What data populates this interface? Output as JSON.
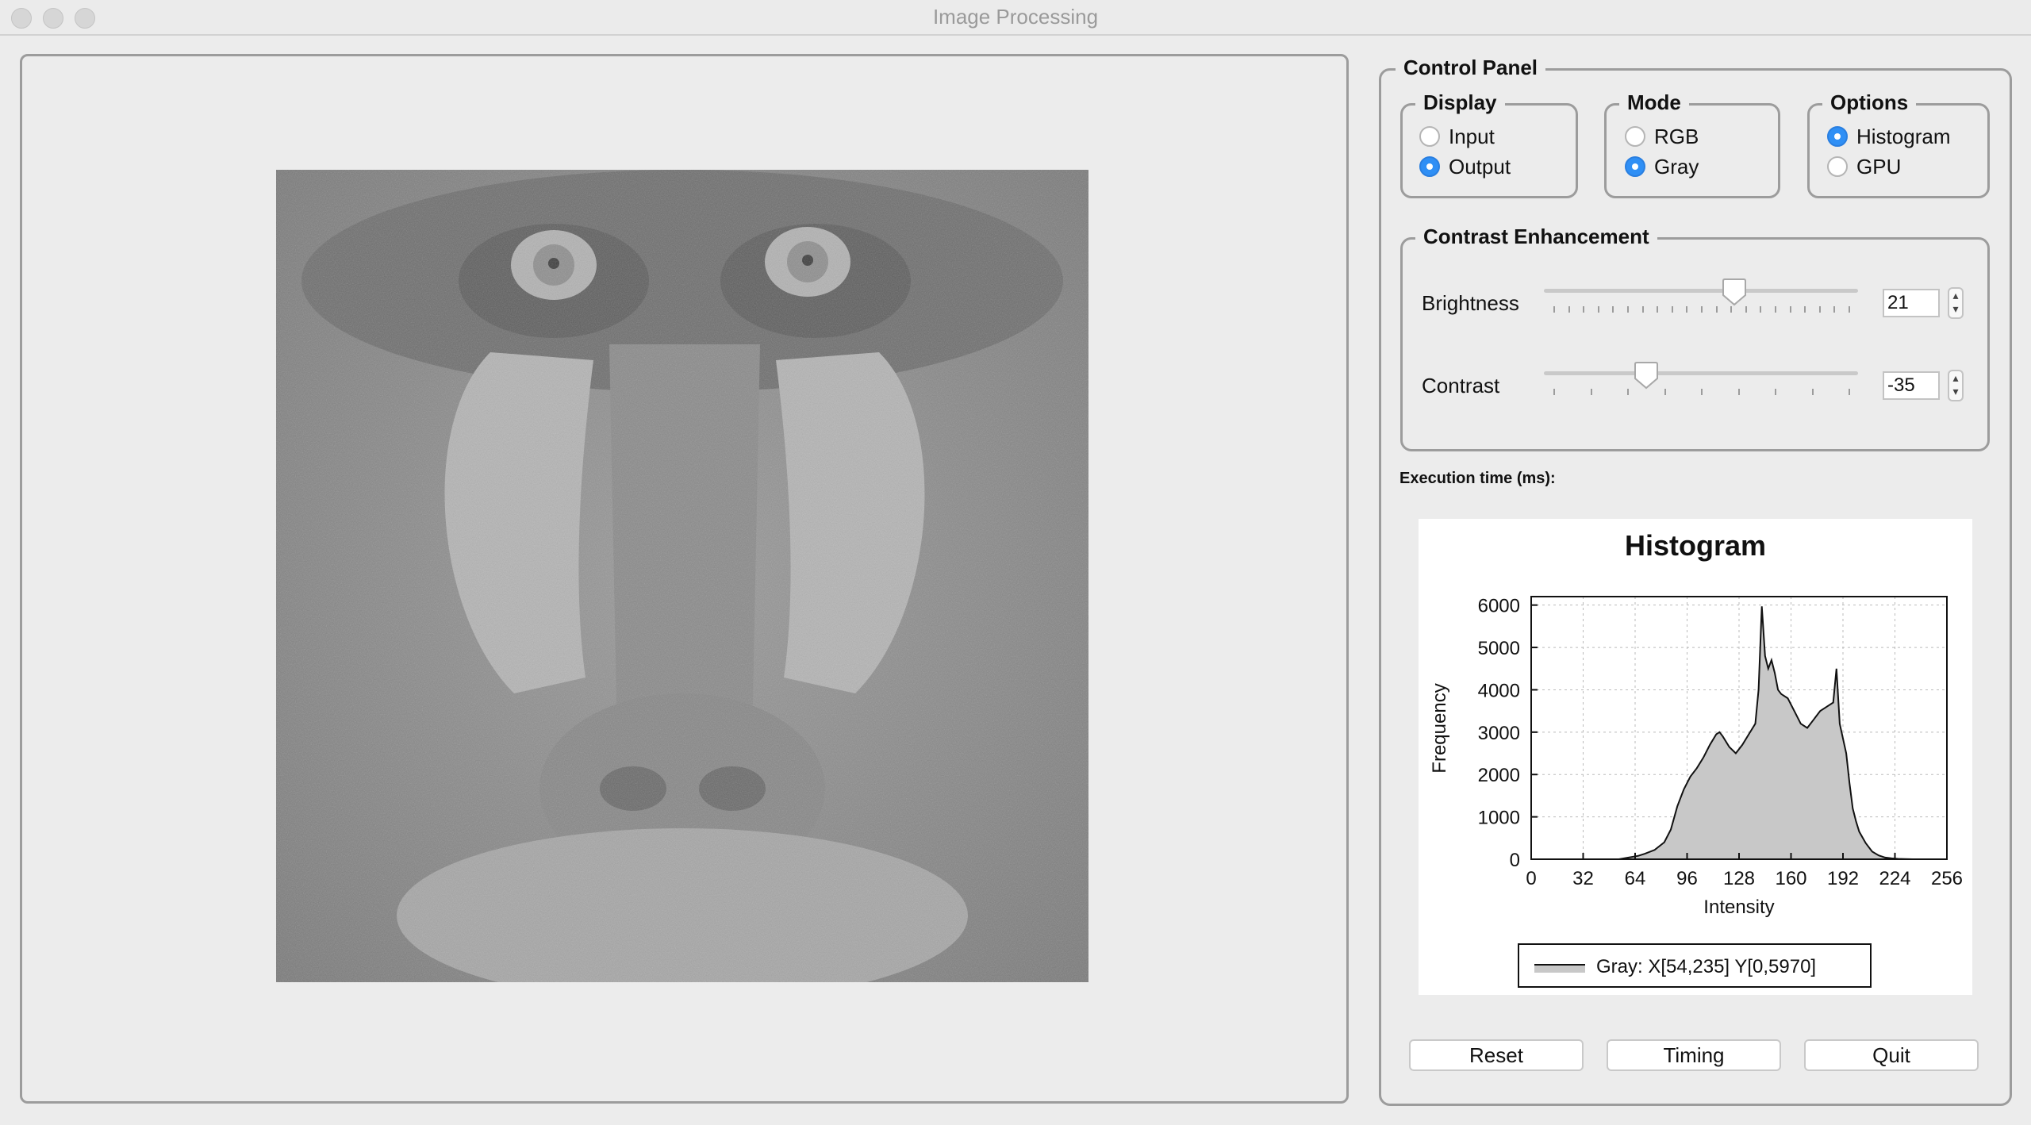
{
  "window": {
    "title": "Image Processing"
  },
  "control_panel": {
    "title": "Control Panel",
    "display": {
      "title": "Display",
      "options": [
        {
          "label": "Input",
          "selected": false
        },
        {
          "label": "Output",
          "selected": true
        }
      ]
    },
    "mode": {
      "title": "Mode",
      "options": [
        {
          "label": "RGB",
          "selected": false
        },
        {
          "label": "Gray",
          "selected": true
        }
      ]
    },
    "options": {
      "title": "Options",
      "options": [
        {
          "label": "Histogram",
          "selected": true
        },
        {
          "label": "GPU",
          "selected": false
        }
      ]
    },
    "contrast_enhancement": {
      "title": "Contrast Enhancement",
      "brightness": {
        "label": "Brightness",
        "value": "21",
        "level": 21,
        "min": -100,
        "max": 100
      },
      "contrast": {
        "label": "Contrast",
        "value": "-35",
        "level": -35,
        "min": -100,
        "max": 100
      }
    },
    "execution_time_label": "Execution time (ms):"
  },
  "buttons": {
    "reset": "Reset",
    "timing": "Timing",
    "quit": "Quit"
  },
  "colors": {
    "accent": "#2f8ff5",
    "histogram_fill": "#c8c8c8",
    "histogram_line": "#111111"
  },
  "chart_data": {
    "type": "area",
    "title": "Histogram",
    "xlabel": "Intensity",
    "ylabel": "Frequency",
    "xlim": [
      0,
      256
    ],
    "ylim": [
      0,
      6200
    ],
    "x_ticks": [
      "0",
      "32",
      "64",
      "96",
      "128",
      "160",
      "192",
      "224",
      "256"
    ],
    "y_ticks": [
      "0",
      "1000",
      "2000",
      "3000",
      "4000",
      "5000",
      "6000"
    ],
    "grid": true,
    "legend": {
      "placement": "bottom",
      "text": "Gray: X[54,235] Y[0,5970]"
    },
    "series": [
      {
        "name": "Gray",
        "x": [
          54,
          60,
          66,
          70,
          76,
          82,
          86,
          90,
          94,
          98,
          102,
          106,
          110,
          114,
          116,
          118,
          122,
          126,
          130,
          134,
          138,
          140,
          142,
          144,
          146,
          148,
          150,
          152,
          154,
          158,
          162,
          166,
          170,
          174,
          178,
          182,
          186,
          188,
          190,
          194,
          196,
          198,
          200,
          202,
          206,
          210,
          214,
          218,
          222,
          226,
          230,
          235
        ],
        "y": [
          0,
          40,
          80,
          130,
          220,
          400,
          700,
          1250,
          1650,
          1950,
          2150,
          2400,
          2700,
          2950,
          3000,
          2900,
          2650,
          2500,
          2700,
          2950,
          3200,
          4000,
          5970,
          4800,
          4500,
          4700,
          4400,
          4000,
          3900,
          3800,
          3500,
          3200,
          3100,
          3300,
          3500,
          3600,
          3700,
          4500,
          3200,
          2500,
          1800,
          1200,
          900,
          650,
          380,
          180,
          90,
          40,
          20,
          10,
          5,
          0
        ]
      }
    ]
  }
}
